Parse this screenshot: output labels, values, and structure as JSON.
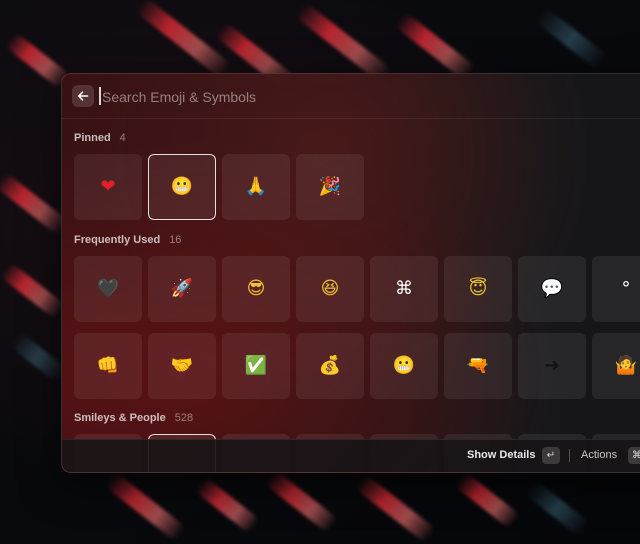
{
  "search": {
    "placeholder": "Search Emoji & Symbols",
    "value": ""
  },
  "sections": {
    "pinned": {
      "title": "Pinned",
      "count": "4"
    },
    "frequent": {
      "title": "Frequently Used",
      "count": "16"
    },
    "smileys": {
      "title": "Smileys & People",
      "count": "528"
    }
  },
  "pinned_items": [
    {
      "name": "red-heart-emoji",
      "glyph": "❤",
      "color": "#e0202a"
    },
    {
      "name": "grimacing-face-emoji",
      "glyph": "😬",
      "color": "#f2c230"
    },
    {
      "name": "folded-hands-emoji",
      "glyph": "🙏",
      "color": "#f0b85a"
    },
    {
      "name": "party-popper-emoji",
      "glyph": "🎉",
      "color": "#f0a23a"
    }
  ],
  "frequent_row1": [
    {
      "name": "black-heart-emoji",
      "glyph": "🖤",
      "color": "#222222"
    },
    {
      "name": "rocket-emoji",
      "glyph": "🚀",
      "color": "#d0d0d0"
    },
    {
      "name": "sunglasses-face-emoji",
      "glyph": "😎",
      "color": "#f2c230"
    },
    {
      "name": "laughing-face-emoji",
      "glyph": "😆",
      "color": "#f2c230"
    },
    {
      "name": "command-key-symbol",
      "glyph": "⌘",
      "color": "#ffffff"
    },
    {
      "name": "halo-face-emoji",
      "glyph": "😇",
      "color": "#f2c230"
    },
    {
      "name": "speech-balloon-emoji",
      "glyph": "💬",
      "color": "#f2f2f2"
    },
    {
      "name": "degree-symbol",
      "glyph": "°",
      "color": "#ffffff"
    }
  ],
  "frequent_row2": [
    {
      "name": "fist-bump-emoji",
      "glyph": "👊",
      "color": "#f2b230"
    },
    {
      "name": "handshake-emoji",
      "glyph": "🤝",
      "color": "#f2b230"
    },
    {
      "name": "check-mark-button-emoji",
      "glyph": "✅",
      "color": "#3cb043"
    },
    {
      "name": "money-bag-emoji",
      "glyph": "💰",
      "color": "#c9a14a"
    },
    {
      "name": "grimacing-face-emoji",
      "glyph": "😬",
      "color": "#f2c230"
    },
    {
      "name": "water-pistol-emoji",
      "glyph": "🔫",
      "color": "#6bc04b"
    },
    {
      "name": "right-arrow-symbol",
      "glyph": "➔",
      "color": "#111111"
    },
    {
      "name": "shrug-emoji",
      "glyph": "🤷",
      "color": "#f2c230"
    }
  ],
  "footer": {
    "primary_action": "Show Details",
    "primary_key": "↵",
    "secondary_action": "Actions",
    "secondary_key": "⌘"
  }
}
